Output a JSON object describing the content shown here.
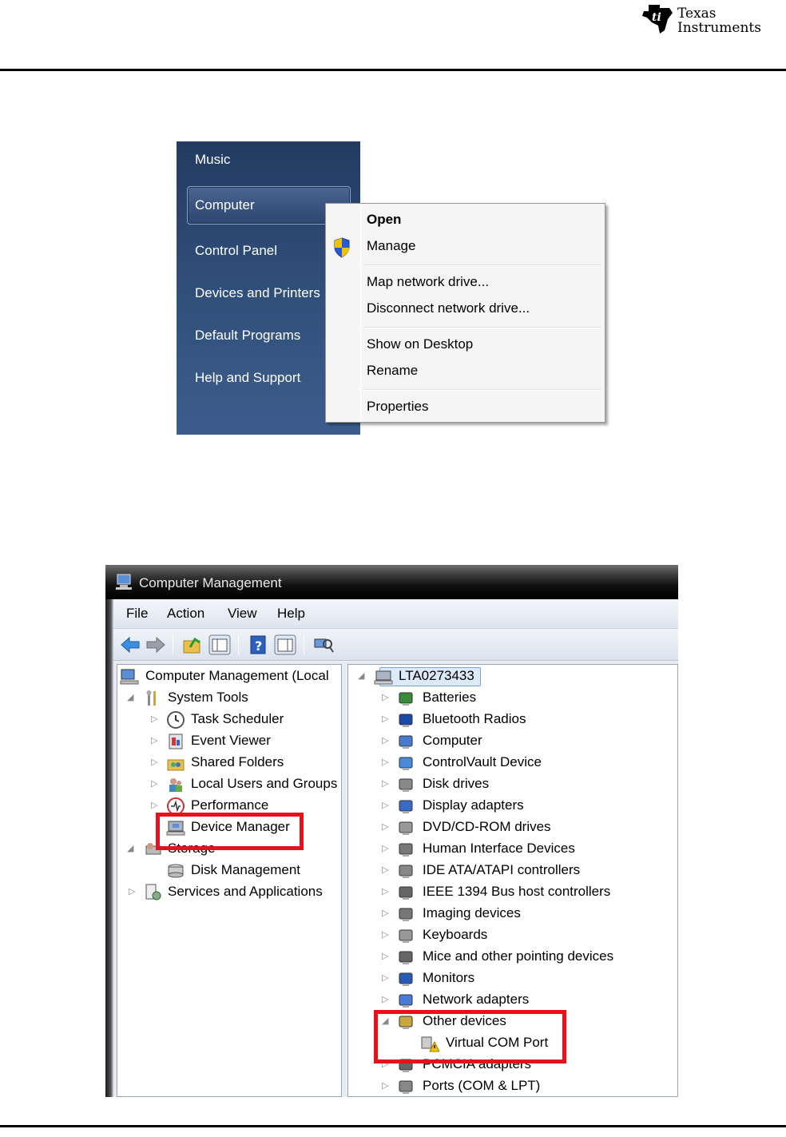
{
  "header": {
    "logo_line1": "Texas",
    "logo_line2": "Instruments"
  },
  "start_menu": {
    "items": [
      "Music",
      "Computer",
      "Control Panel",
      "Devices and Printers",
      "Default Programs",
      "Help and Support"
    ]
  },
  "context_menu": {
    "items": [
      "Open",
      "Manage",
      "Map network drive...",
      "Disconnect network drive...",
      "Show on Desktop",
      "Rename",
      "Properties"
    ]
  },
  "computer_management": {
    "title": "Computer Management",
    "menu": [
      "File",
      "Action",
      "View",
      "Help"
    ],
    "left_tree": [
      "Computer Management (Local",
      "System Tools",
      "Task Scheduler",
      "Event Viewer",
      "Shared Folders",
      "Local Users and Groups",
      "Performance",
      "Device Manager",
      "Storage",
      "Disk Management",
      "Services and Applications"
    ],
    "right_tree": {
      "root": "LTA0273433",
      "items": [
        "Batteries",
        "Bluetooth Radios",
        "Computer",
        "ControlVault Device",
        "Disk drives",
        "Display adapters",
        "DVD/CD-ROM drives",
        "Human Interface Devices",
        "IDE ATA/ATAPI controllers",
        "IEEE 1394 Bus host controllers",
        "Imaging devices",
        "Keyboards",
        "Mice and other pointing devices",
        "Monitors",
        "Network adapters",
        "Other devices",
        "Virtual COM Port",
        "PCMCIA adapters",
        "Ports (COM & LPT)"
      ]
    },
    "highlight_color": "#e8101a"
  }
}
